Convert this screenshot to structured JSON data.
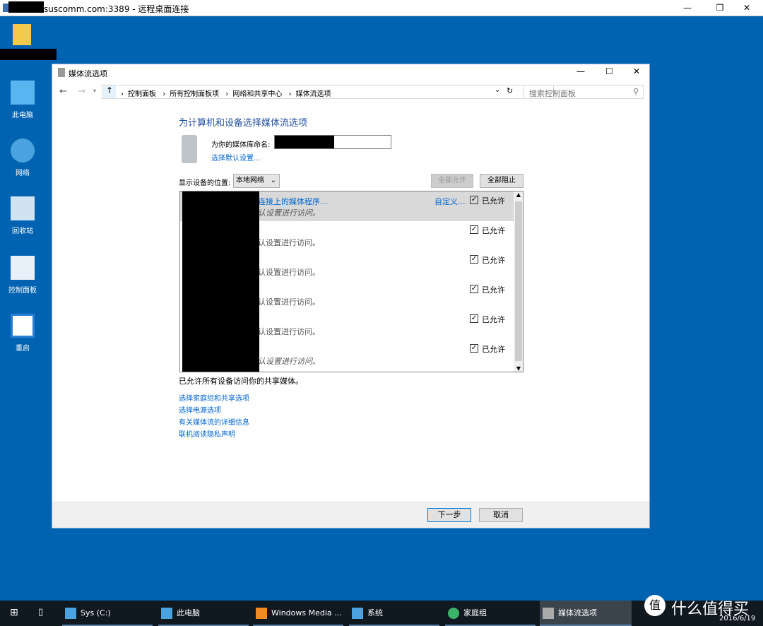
{
  "rdp": {
    "title": "suscomm.com:3389 - 远程桌面连接"
  },
  "desktop": [
    {
      "label": "此电脑"
    },
    {
      "label": "网络"
    },
    {
      "label": "回收站"
    },
    {
      "label": "控制面板"
    },
    {
      "label": "重启"
    }
  ],
  "window": {
    "title": "媒体流选项",
    "breadcrumb": [
      "控制面板",
      "所有控制面板项",
      "网络和共享中心",
      "媒体流选项"
    ],
    "search_placeholder": "搜索控制面板",
    "heading": "为计算机和设备选择媒体流选项",
    "library_label": "为你的媒体库命名:",
    "choose_default": "选择默认设置...",
    "show_devices_label": "显示设备的位置:",
    "location": "本地网络",
    "allow_all": "全部允许",
    "block_all": "全部阻止",
    "devices": [
      {
        "name": "连接上的媒体程序...",
        "desc": "认设置进行访问。",
        "customize": "自定义...",
        "status": "已允许",
        "checked": true
      },
      {
        "desc": "认设置进行访问。",
        "status": "已允许",
        "checked": true
      },
      {
        "desc": "认设置进行访问。",
        "status": "已允许",
        "checked": true
      },
      {
        "desc": "认设置进行访问。",
        "status": "已允许",
        "checked": true
      },
      {
        "desc": "认设置进行访问。",
        "status": "已允许",
        "checked": true
      },
      {
        "desc": "认设置进行访问。",
        "status": "已允许",
        "checked": true
      }
    ],
    "summary": "已允许所有设备访问你的共享媒体。",
    "links": [
      "选择家庭组和共享选项",
      "选择电源选项",
      "有关媒体流的详细信息",
      "联机阅读隐私声明"
    ],
    "next": "下一步",
    "cancel": "取消"
  },
  "taskbar": {
    "items": [
      "Sys (C:)",
      "此电脑",
      "Windows Media ...",
      "系统",
      "家庭组",
      "媒体流选项"
    ],
    "date": "2016/6/19",
    "watermark": "什么值得买"
  }
}
